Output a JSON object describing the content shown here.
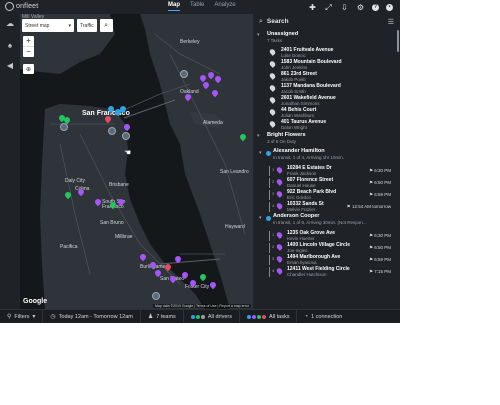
{
  "app": {
    "logo_text": "onfleet"
  },
  "nav": {
    "tabs": [
      "Map",
      "Table",
      "Analyze"
    ],
    "active_tab": "Map"
  },
  "top_actions": [
    "add-icon",
    "fullscreen-icon",
    "export-icon",
    "settings-icon",
    "help-icon",
    "account-icon"
  ],
  "map": {
    "style_select": "Street map",
    "traffic_label": "Traffic",
    "zoom_in": "+",
    "zoom_out": "−",
    "locate_icon": "crosshair-icon",
    "labels": {
      "mill_valley": "Mill Valley",
      "berkeley": "Berkeley",
      "oakland": "Oakland",
      "san_francisco": "San Francisco",
      "alameda": "Alameda",
      "daly_city": "Daly City",
      "colma": "Colma",
      "brisbane": "Brisbane",
      "south_san_francisco": "South San Francisco",
      "san_bruno": "San Bruno",
      "pacifica": "Pacifica",
      "millbrae": "Millbrae",
      "burlingame": "Burlingame",
      "san_mateo": "San Mateo",
      "foster_city": "Foster City",
      "hayward": "Hayward",
      "san_leandro": "San Leandro"
    },
    "google": "Google",
    "attribution": "Map data ©2019 Google  |  Terms of Use  |  Report a map error"
  },
  "panel": {
    "search_label": "Search",
    "groups": [
      {
        "title": "Unassigned",
        "subtitle": "7 Tasks",
        "tasks": [
          {
            "title": "2401 Fruitvale Avenue",
            "name": "Luke Doncic"
          },
          {
            "title": "1583 Mountain Boulevard",
            "name": "John Jenkins"
          },
          {
            "title": "861 23rd Street",
            "name": "Jakob Poeltl"
          },
          {
            "title": "1137 Mandana Boulevard",
            "name": "Jacob Smith"
          },
          {
            "title": "2601 Wakefield Avenue",
            "name": "Jonathan Simmons"
          },
          {
            "title": "44 Behis Court",
            "name": "Julian Washburn"
          },
          {
            "title": "401 Taurus Avenue",
            "name": "Dalon Wright"
          }
        ]
      },
      {
        "title": "Bright Flowers",
        "subtitle": "3 of 6 On Duty",
        "drivers": [
          {
            "name": "Alexander Hamilton",
            "status": "In transit, 1 of 4, Arriving 1hr 10min.",
            "tasks": [
              {
                "num": "1",
                "title": "10284 E Estates Dr",
                "name": "Frank Jackson",
                "eta": "6:30 PM"
              },
              {
                "num": "2",
                "title": "607 Florence Street",
                "name": "Danuel House",
                "eta": "6:50 PM"
              },
              {
                "num": "3",
                "title": "922 Beach Park Blvd",
                "name": "Eric Gordon",
                "eta": "6:59 PM"
              },
              {
                "num": "4",
                "title": "10332 Sands St",
                "name": "Melvin Frazier",
                "eta": "12:54 AM tomorrow"
              }
            ]
          },
          {
            "name": "Anderson Cooper",
            "status": "In transit, 1 of 6, Arriving 30min.  (Not Respon...",
            "tasks": [
              {
                "num": "1",
                "title": "1235 Oak Grove Ave",
                "name": "Kevin Huerter",
                "eta": "6:30 PM"
              },
              {
                "num": "2",
                "title": "1400 Lincoln Village Circle",
                "name": "Joe Ingles",
                "eta": "6:50 PM"
              },
              {
                "num": "3",
                "title": "1494 Marlborough Ave",
                "name": "Ersan Ilyasova",
                "eta": "6:59 PM"
              },
              {
                "num": "4",
                "title": "12411 West Fielding Circle",
                "name": "Chandler Hutchison",
                "eta": "7:15 PM"
              }
            ]
          }
        ]
      }
    ]
  },
  "bottombar": {
    "filters": "Filters",
    "date_range": "Today 12am - Tomorrow 12am",
    "teams": "7 teams",
    "drivers": "All drivers",
    "tasks": "All tasks",
    "connection": "1 connection"
  },
  "colors": {
    "bg": "#1f2327",
    "accent": "#4aa3ff",
    "driver_dot": "#2fa3e6",
    "task_purple": "#a855f7",
    "task_green": "#22c55e"
  }
}
